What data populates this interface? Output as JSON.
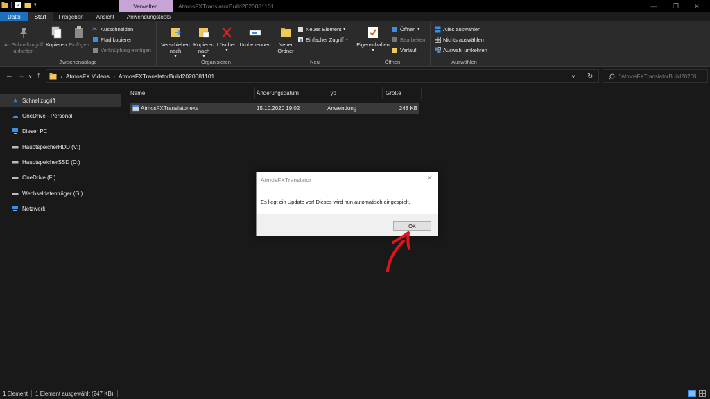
{
  "titlebar": {
    "context_tab": "Verwalten",
    "window_title": "AtmosFXTranslatorBuild2020081101",
    "minimize": "—",
    "maximize": "❐",
    "close": "✕"
  },
  "tabs": [
    "Datei",
    "Start",
    "Freigeben",
    "Ansicht",
    "Anwendungstools"
  ],
  "ribbon": {
    "zwischenablage": {
      "label": "Zwischenablage",
      "pin": "An Schnellzugriff anheften",
      "pin_l1": "An Schnellzugriff",
      "pin_l2": "anheften",
      "copy": "Kopieren",
      "paste": "Einfügen",
      "cut": "Ausschneiden",
      "copy_path": "Pfad kopieren",
      "paste_link": "Verknüpfung einfügen"
    },
    "organisieren": {
      "label": "Organisieren",
      "move_l1": "Verschieben",
      "move_l2": "nach",
      "copyto_l1": "Kopieren",
      "copyto_l2": "nach",
      "delete": "Löschen",
      "rename": "Umbenennen"
    },
    "neu": {
      "label": "Neu",
      "folder_l1": "Neuer",
      "folder_l2": "Ordner",
      "new_item": "Neues Element",
      "easy_access": "Einfacher Zugriff"
    },
    "oeffnen": {
      "label": "Öffnen",
      "properties": "Eigenschaften",
      "open": "Öffnen",
      "edit": "Bearbeiten",
      "history": "Verlauf"
    },
    "auswaehlen": {
      "label": "Auswählen",
      "select_all": "Alles auswählen",
      "select_none": "Nichts auswählen",
      "invert": "Auswahl umkehren"
    }
  },
  "address": {
    "crumbs": [
      "AtmosFX Videos",
      "AtmosFXTranslatorBuild2020081101"
    ],
    "search_placeholder": "\"AtmosFXTranslatorBuild20200..."
  },
  "sidebar": {
    "items": [
      {
        "label": "Schnellzugriff",
        "icon": "star-icon"
      },
      {
        "label": "OneDrive - Personal",
        "icon": "cloud-icon"
      },
      {
        "label": "Dieser PC",
        "icon": "pc-icon"
      },
      {
        "label": "HauptspeicherHDD (V:)",
        "icon": "drive-icon"
      },
      {
        "label": "HauptspeicherSSD (D:)",
        "icon": "drive-icon"
      },
      {
        "label": "OneDrive (F:)",
        "icon": "drive-icon"
      },
      {
        "label": "Wechseldatenträger (G:)",
        "icon": "drive-icon"
      },
      {
        "label": "Netzwerk",
        "icon": "network-icon"
      }
    ]
  },
  "filelist": {
    "columns": [
      "Name",
      "Änderungsdatum",
      "Typ",
      "Größe"
    ],
    "rows": [
      {
        "name": "AtmosFXTranslator.exe",
        "date": "15.10.2020 19:02",
        "type": "Anwendung",
        "size": "248 KB"
      }
    ]
  },
  "status": {
    "count": "1 Element",
    "selected": "1 Element ausgewählt (247 KB)"
  },
  "dialog": {
    "title": "AtmosFXTranslator",
    "message": "Es liegt ein Update vor! Dieses wird nun automatisch eingespielt.",
    "ok": "OK"
  },
  "colors": {
    "accent": "#1f6fbf",
    "context_tab": "#c7a3d6",
    "annotation_arrow": "#e0151b"
  }
}
